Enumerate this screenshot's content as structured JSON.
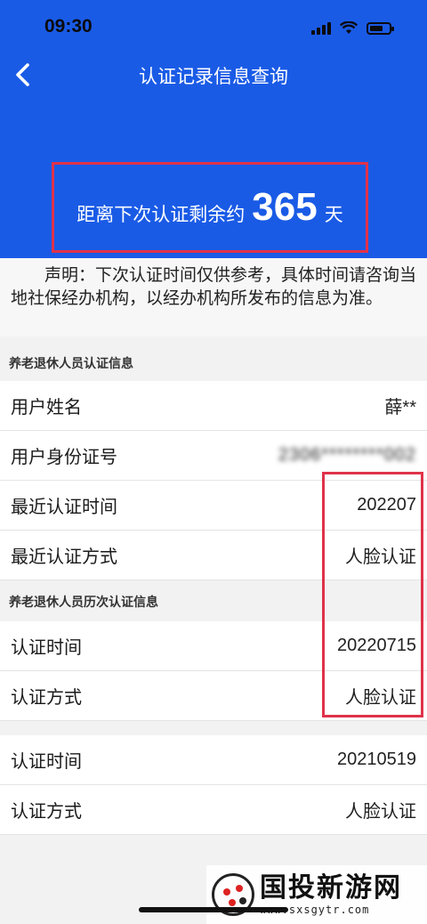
{
  "status_bar": {
    "time": "09:30"
  },
  "nav": {
    "title": "认证记录信息查询"
  },
  "remaining": {
    "prefix": "距离下次认证剩余约",
    "days": "365",
    "unit": "天"
  },
  "notice": "声明：下次认证时间仅供参考，具体时间请咨询当地社保经办机构，以经办机构所发布的信息为准。",
  "section1": {
    "title": "养老退休人员认证信息",
    "rows": [
      {
        "label": "用户姓名",
        "value": "薛**"
      },
      {
        "label": "用户身份证号",
        "value": "2306********002"
      },
      {
        "label": "最近认证时间",
        "value": "202207"
      },
      {
        "label": "最近认证方式",
        "value": "人脸认证"
      }
    ]
  },
  "section2": {
    "title": "养老退休人员历次认证信息",
    "records": [
      {
        "time_label": "认证时间",
        "time_value": "20220715",
        "method_label": "认证方式",
        "method_value": "人脸认证"
      },
      {
        "time_label": "认证时间",
        "time_value": "20210519",
        "method_label": "认证方式",
        "method_value": "人脸认证"
      }
    ]
  },
  "watermark": {
    "name": "国投新游网",
    "url": "www.sxsgytr.com"
  },
  "colors": {
    "header_blue": "#1a5be6",
    "highlight_red": "#e0324a"
  }
}
